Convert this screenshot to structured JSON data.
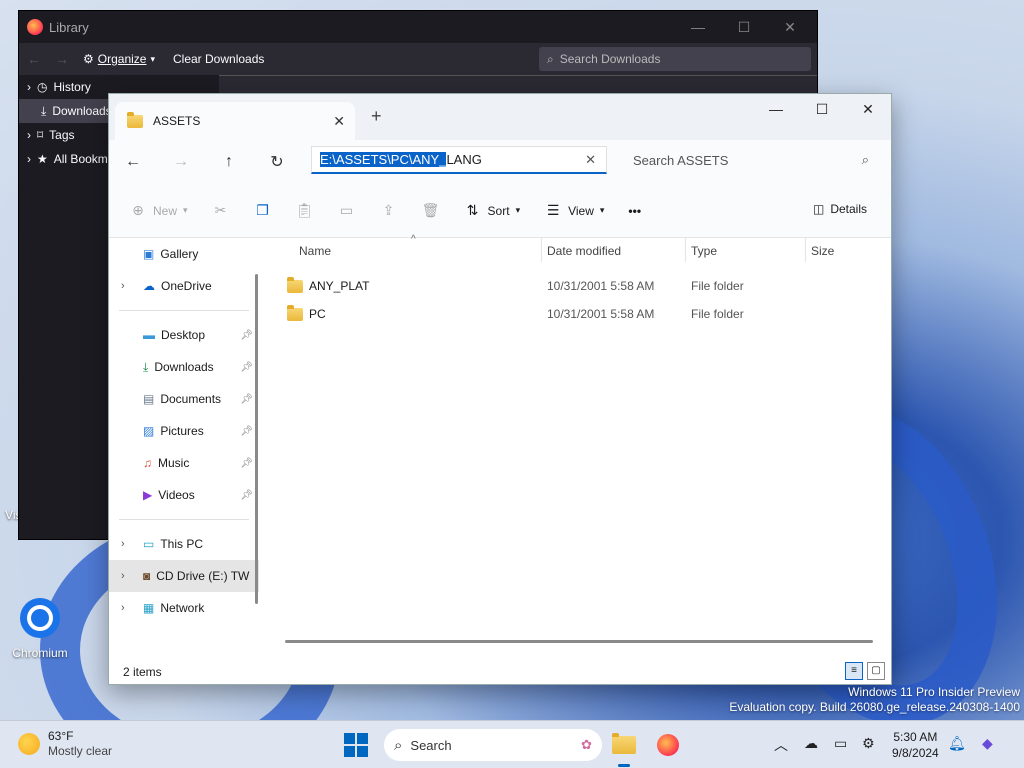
{
  "desktop": {
    "icons": [
      {
        "label": "Visual Studio Code"
      },
      {
        "label": "Chromium"
      }
    ],
    "watermark_line1": "Windows 11 Pro Insider Preview",
    "watermark_line2": "Evaluation copy. Build 26080.ge_release.240308-1400"
  },
  "library": {
    "title": "Library",
    "toolbar": {
      "organize": "Organize",
      "clear": "Clear Downloads"
    },
    "search_placeholder": "Search Downloads",
    "sidebar": [
      {
        "label": "History"
      },
      {
        "label": "Downloads"
      },
      {
        "label": "Tags"
      },
      {
        "label": "All Bookmarks"
      }
    ]
  },
  "explorer": {
    "tab_title": "ASSETS",
    "address_selected": "E:\\ASSETS\\PC\\ANY_",
    "address_rest": "LANG",
    "search_placeholder": "Search ASSETS",
    "commands": {
      "new": "New",
      "sort": "Sort",
      "view": "View",
      "more": "•••",
      "details": "Details"
    },
    "nav": [
      {
        "label": "Gallery",
        "icon": "gallery-icon"
      },
      {
        "label": "OneDrive",
        "icon": "cloud-icon"
      },
      {
        "label": "Desktop",
        "icon": "desktop-icon"
      },
      {
        "label": "Downloads",
        "icon": "download-icon"
      },
      {
        "label": "Documents",
        "icon": "document-icon"
      },
      {
        "label": "Pictures",
        "icon": "picture-icon"
      },
      {
        "label": "Music",
        "icon": "music-icon"
      },
      {
        "label": "Videos",
        "icon": "video-icon"
      },
      {
        "label": "This PC",
        "icon": "computer-icon"
      },
      {
        "label": "CD Drive (E:) TW",
        "icon": "cd-drive-icon"
      },
      {
        "label": "Network",
        "icon": "network-icon"
      }
    ],
    "columns": {
      "name": "Name",
      "date": "Date modified",
      "type": "Type",
      "size": "Size"
    },
    "rows": [
      {
        "name": "ANY_PLAT",
        "date": "10/31/2001 5:58 AM",
        "type": "File folder"
      },
      {
        "name": "PC",
        "date": "10/31/2001 5:58 AM",
        "type": "File folder"
      }
    ],
    "status": "2 items"
  },
  "taskbar": {
    "weather_temp": "63°F",
    "weather_desc": "Mostly clear",
    "search_label": "Search",
    "time": "5:30 AM",
    "date": "9/8/2024"
  },
  "colors": {
    "accent": "#0a63c9",
    "folder": "#eab83b"
  }
}
